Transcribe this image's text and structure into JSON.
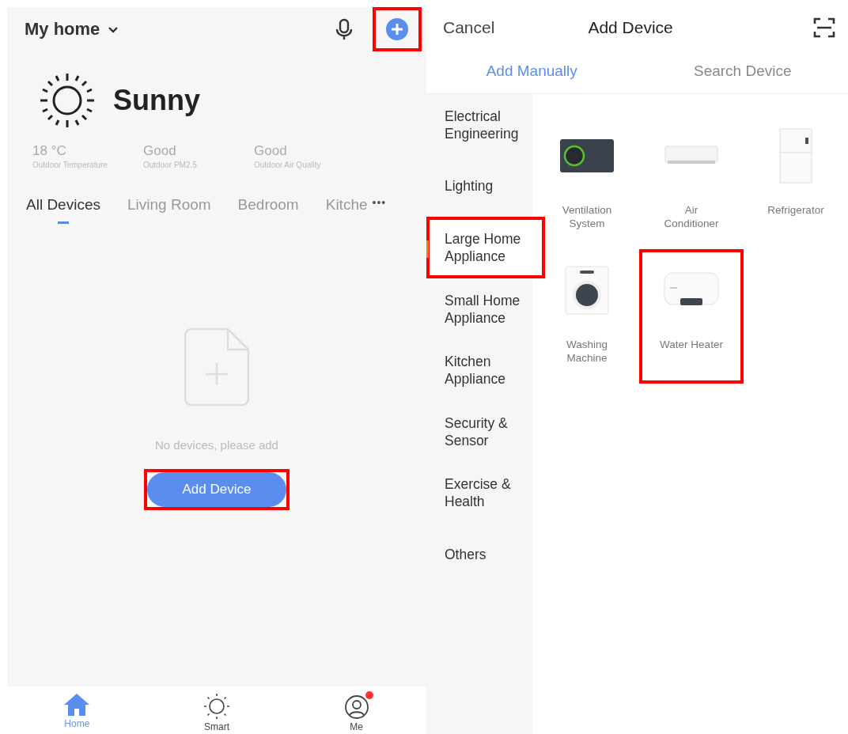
{
  "home": {
    "title": "My home",
    "add_highlighted": true,
    "weather": {
      "condition": "Sunny",
      "stats": [
        {
          "value": "18 °C",
          "label": "Outdoor Temperature"
        },
        {
          "value": "Good",
          "label": "Outdoor PM2.5"
        },
        {
          "value": "Good",
          "label": "Outdoor Air Quality"
        }
      ]
    },
    "tabs": [
      {
        "label": "All Devices",
        "selected": true
      },
      {
        "label": "Living Room",
        "selected": false
      },
      {
        "label": "Bedroom",
        "selected": false
      },
      {
        "label": "Kitche",
        "selected": false
      }
    ],
    "more": "•••",
    "empty": {
      "message": "No devices, please add",
      "button": "Add Device",
      "highlighted": true
    },
    "nav": [
      {
        "label": "Home",
        "kind": "home",
        "selected": true,
        "badge": false
      },
      {
        "label": "Smart",
        "kind": "smart",
        "selected": false,
        "badge": false
      },
      {
        "label": "Me",
        "kind": "me",
        "selected": false,
        "badge": true
      }
    ]
  },
  "add_device": {
    "cancel": "Cancel",
    "title": "Add Device",
    "tabs": [
      {
        "label": "Add Manually",
        "selected": true
      },
      {
        "label": "Search Device",
        "selected": false
      }
    ],
    "categories": [
      {
        "label": "Electrical Engineering",
        "selected": false,
        "highlighted": false
      },
      {
        "label": "Lighting",
        "selected": false,
        "highlighted": false
      },
      {
        "label": "Large Home Appliance",
        "selected": true,
        "highlighted": true
      },
      {
        "label": "Small Home Appliance",
        "selected": false,
        "highlighted": false
      },
      {
        "label": "Kitchen Appliance",
        "selected": false,
        "highlighted": false
      },
      {
        "label": "Security & Sensor",
        "selected": false,
        "highlighted": false
      },
      {
        "label": "Exercise & Health",
        "selected": false,
        "highlighted": false
      },
      {
        "label": "Others",
        "selected": false,
        "highlighted": false
      }
    ],
    "devices": [
      {
        "kind": "ventilation",
        "label": "Ventilation System",
        "highlighted": false
      },
      {
        "kind": "ac",
        "label": "Air Conditioner",
        "highlighted": false
      },
      {
        "kind": "fridge",
        "label": "Refrigerator",
        "highlighted": false
      },
      {
        "kind": "washer",
        "label": "Washing Machine",
        "highlighted": false
      },
      {
        "kind": "heater",
        "label": "Water Heater",
        "highlighted": true
      }
    ]
  }
}
